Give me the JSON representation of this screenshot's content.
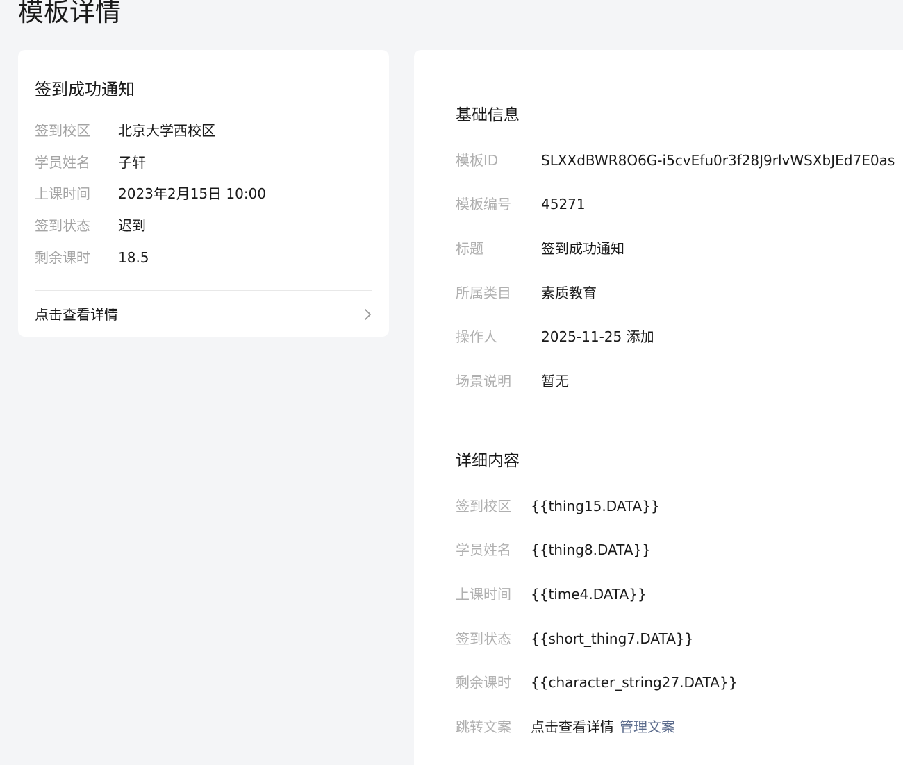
{
  "page": {
    "title": "模板详情"
  },
  "preview": {
    "title": "签到成功通知",
    "rows": [
      {
        "label": "签到校区",
        "value": "北京大学西校区"
      },
      {
        "label": "学员姓名",
        "value": "子轩"
      },
      {
        "label": "上课时间",
        "value": "2023年2月15日 10:00"
      },
      {
        "label": "签到状态",
        "value": "迟到"
      },
      {
        "label": "剩余课时",
        "value": "18.5"
      }
    ],
    "link_label": "点击查看详情",
    "link_icon": "chevron-right-icon"
  },
  "basic_info": {
    "title": "基础信息",
    "rows": [
      {
        "label": "模板ID",
        "value": "SLXXdBWR8O6G-i5cvEfu0r3f28J9rlvWSXbJEd7E0as"
      },
      {
        "label": "模板编号",
        "value": "45271"
      },
      {
        "label": "标题",
        "value": "签到成功通知"
      },
      {
        "label": "所属类目",
        "value": "素质教育"
      },
      {
        "label": "操作人",
        "value": "2025-11-25 添加"
      },
      {
        "label": "场景说明",
        "value": "暂无"
      }
    ]
  },
  "details": {
    "title": "详细内容",
    "rows": [
      {
        "label": "签到校区",
        "value": "{{thing15.DATA}}"
      },
      {
        "label": "学员姓名",
        "value": "{{thing8.DATA}}"
      },
      {
        "label": "上课时间",
        "value": "{{time4.DATA}}"
      },
      {
        "label": "签到状态",
        "value": "{{short_thing7.DATA}}"
      },
      {
        "label": "剩余课时",
        "value": "{{character_string27.DATA}}"
      },
      {
        "label": "跳转文案",
        "value": "点击查看详情",
        "link": "管理文案"
      }
    ]
  },
  "colors": {
    "background": "#f4f5f7",
    "card": "#ffffff",
    "label": "#b0b0b0",
    "link": "#5b6b8c"
  }
}
